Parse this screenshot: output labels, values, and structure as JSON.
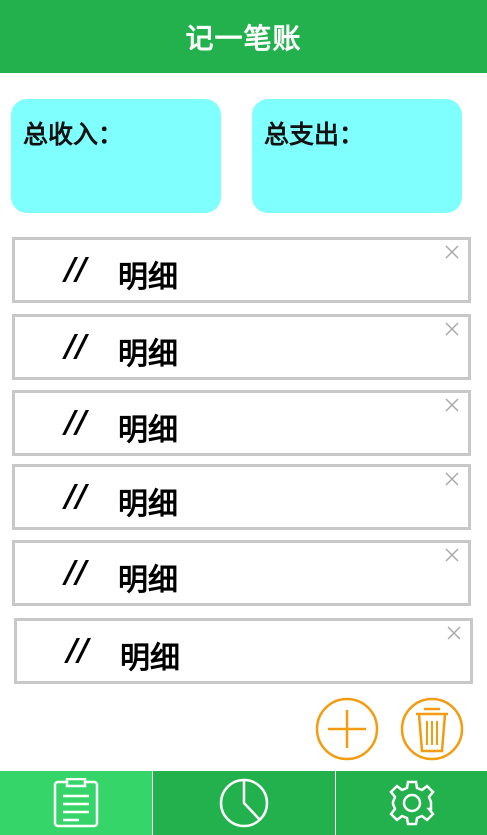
{
  "header": {
    "title": "记一笔账"
  },
  "summary": {
    "income_label": "总收入：",
    "expense_label": "总支出："
  },
  "records": [
    {
      "prefix": "//",
      "label": "明细"
    },
    {
      "prefix": "//",
      "label": "明细"
    },
    {
      "prefix": "//",
      "label": "明细"
    },
    {
      "prefix": "//",
      "label": "明细"
    },
    {
      "prefix": "//",
      "label": "明细"
    },
    {
      "prefix": "//",
      "label": "明细"
    }
  ],
  "actions": {
    "add_icon": "plus-circle-icon",
    "delete_icon": "trash-icon",
    "accent": "#f39c12"
  },
  "bottom_nav": [
    {
      "icon": "ledger-icon",
      "active": true
    },
    {
      "icon": "pie-chart-icon",
      "active": false
    },
    {
      "icon": "gear-icon",
      "active": false
    }
  ],
  "colors": {
    "header": "#22b14c",
    "card": "#80ffff",
    "active_tab": "#35d56a"
  }
}
